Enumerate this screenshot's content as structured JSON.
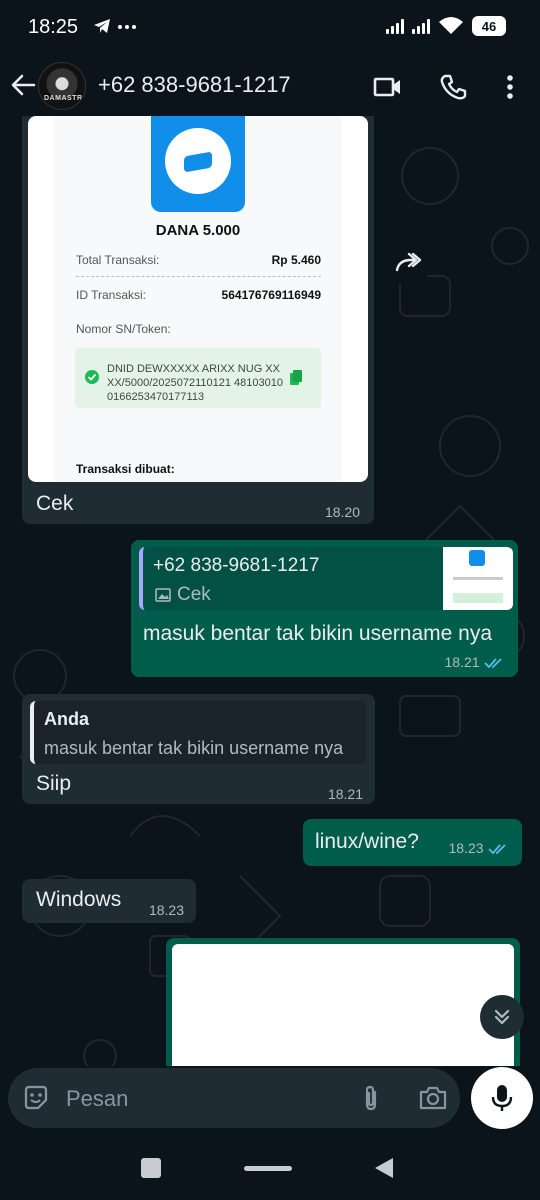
{
  "status": {
    "time": "18:25",
    "left_icons": [
      "telegram-icon",
      "more-dots"
    ],
    "battery": "46"
  },
  "header": {
    "avatar_text": "DAMASTR",
    "contact": "+62 838-9681-1217",
    "icons": [
      "back-arrow-icon",
      "video-call-icon",
      "voice-call-icon",
      "more-vert-icon"
    ]
  },
  "messages": {
    "m1": {
      "receipt": {
        "product": "DANA 5.000",
        "total_label": "Total Transaksi:",
        "total_value": "Rp 5.460",
        "id_label": "ID Transaksi:",
        "id_value": "564176769116949",
        "sn_label": "Nomor SN/Token:",
        "sn_text": "DNID DEWXXXXX ARIXX NUG XXXX/5000/2025072110121 481030100166253470177113",
        "created_label": "Transaksi dibuat:"
      },
      "caption": "Cek",
      "time": "18.20"
    },
    "m2": {
      "quote_name": "+62 838-9681-1217",
      "quote_text": "Cek",
      "text": "masuk bentar tak bikin username nya",
      "time": "18.21"
    },
    "m3": {
      "quote_name": "Anda",
      "quote_text": "masuk bentar tak bikin username nya",
      "text": "Siip",
      "time": "18.21"
    },
    "m4": {
      "text": "linux/wine?",
      "time": "18.23"
    },
    "m5": {
      "text": "Windows",
      "time": "18.23"
    }
  },
  "composer": {
    "placeholder": "Pesan"
  },
  "colors": {
    "background": "#0b141a",
    "incoming": "#202c33",
    "outgoing": "#005c4b",
    "read_ticks": "#53bdeb",
    "dana_blue": "#118eea"
  }
}
